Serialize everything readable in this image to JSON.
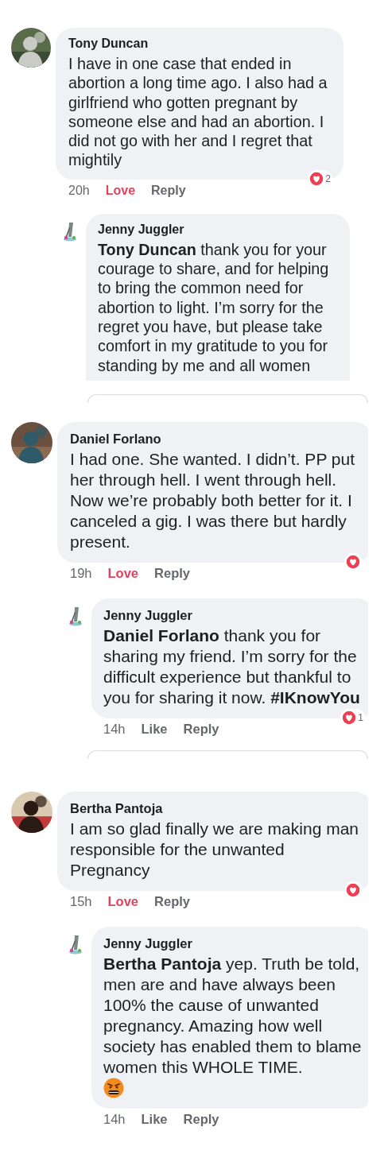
{
  "threads": [
    {
      "comment": {
        "author": "Tony Duncan",
        "text": "I have in one case that ended in abortion a long time ago. I also had a girlfriend who gotten pregnant by someone else and had an abortion.  I did not go with her and I regret that mightily",
        "time": "20h",
        "reaction": {
          "label": "Love",
          "selected": true
        },
        "reply_label": "Reply",
        "love_badge": true,
        "love_count": "2"
      },
      "reply": {
        "author": "Jenny Juggler",
        "text": "**Tony Duncan** thank you for your courage to share, and for helping to bring the common need for abortion to light.  I’m sorry for the regret you have, but please take comfort in my gratitude to you for standing by me and all women",
        "clipped": true
      },
      "peek": true
    },
    {
      "comment": {
        "author": "Daniel Forlano",
        "text": "I had one. She wanted. I didn’t. PP put her through hell. I went through hell. Now we’re probably both better for it. I canceled a gig. I was there but hardly present.",
        "time": "19h",
        "reaction": {
          "label": "Love",
          "selected": true
        },
        "reply_label": "Reply",
        "love_badge": true
      },
      "reply": {
        "author": "Jenny Juggler",
        "text": "**Daniel Forlano** thank you for sharing my friend.  I’m sorry for the difficult experience but thankful to you for sharing it now. **#IKnowYou**",
        "time": "14h",
        "reaction": {
          "label": "Like",
          "selected": false
        },
        "reply_label": "Reply",
        "love_badge": true,
        "love_count": "1"
      },
      "peek": true
    },
    {
      "comment": {
        "author": "Bertha Pantoja",
        "text": "I am so glad finally we are making man responsible for the unwanted Pregnancy",
        "time": "15h",
        "reaction": {
          "label": "Love",
          "selected": true
        },
        "reply_label": "Reply",
        "love_badge": true
      },
      "reply": {
        "author": "Jenny Juggler",
        "text": "**Bertha Pantoja** yep.  Truth be told, men are and have always been 100% the cause of unwanted pregnancy.  Amazing how well society has enabled them to blame women this WHOLE TIME.",
        "sticker": true,
        "time": "14h",
        "reaction": {
          "label": "Like",
          "selected": false
        },
        "reply_label": "Reply"
      }
    }
  ]
}
